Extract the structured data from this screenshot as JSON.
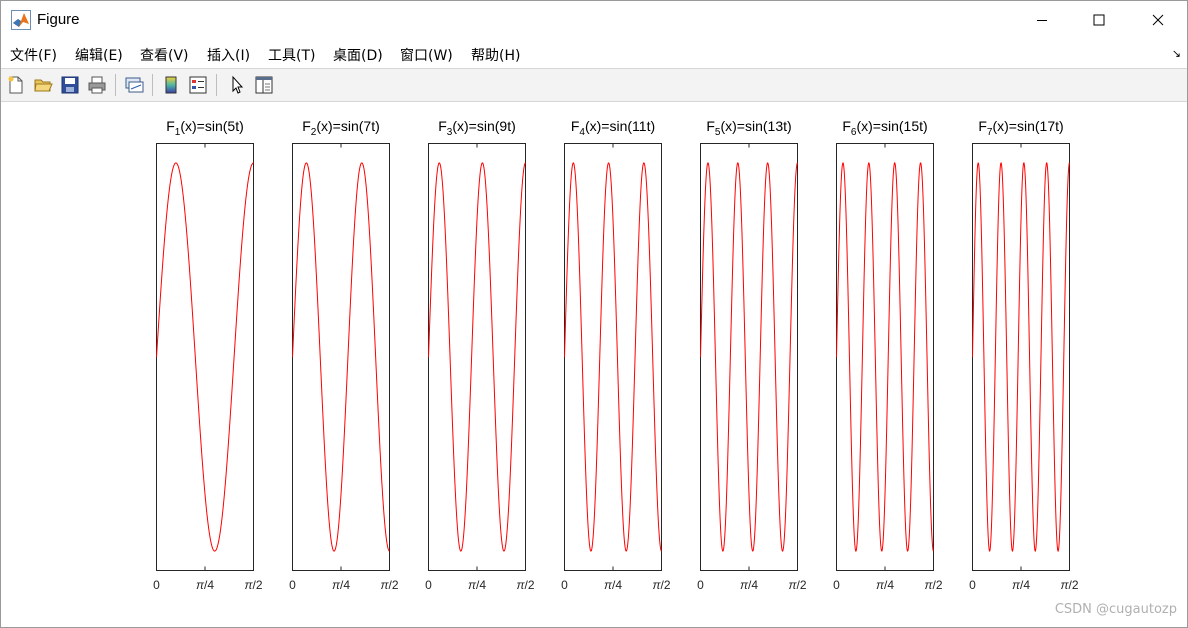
{
  "window": {
    "title": "Figure",
    "icon": "matlab-icon"
  },
  "menu": [
    {
      "label": "文件(F)"
    },
    {
      "label": "编辑(E)"
    },
    {
      "label": "查看(V)"
    },
    {
      "label": "插入(I)"
    },
    {
      "label": "工具(T)"
    },
    {
      "label": "桌面(D)"
    },
    {
      "label": "窗口(W)"
    },
    {
      "label": "帮助(H)"
    }
  ],
  "toolbar": {
    "icons": [
      "new-file-icon",
      "open-folder-icon",
      "save-icon",
      "print-icon",
      "link-plot-icon",
      "colorbar-icon",
      "legend-icon",
      "pointer-icon",
      "property-editor-icon"
    ]
  },
  "watermark": "CSDN @cugautozp",
  "chart_data": [
    {
      "type": "line",
      "title": "F",
      "title_sub": "1",
      "title_rest": "(x)=sin(5t)",
      "freq": 5,
      "x_ticks": [
        "0",
        "π/4",
        "π/2"
      ],
      "xlim": [
        0,
        1.5708
      ],
      "ylim": [
        -1.1,
        1.1
      ],
      "line_color": "#ff0000"
    },
    {
      "type": "line",
      "title": "F",
      "title_sub": "2",
      "title_rest": "(x)=sin(7t)",
      "freq": 7,
      "x_ticks": [
        "0",
        "π/4",
        "π/2"
      ],
      "xlim": [
        0,
        1.5708
      ],
      "ylim": [
        -1.1,
        1.1
      ],
      "line_color": "#ff0000"
    },
    {
      "type": "line",
      "title": "F",
      "title_sub": "3",
      "title_rest": "(x)=sin(9t)",
      "freq": 9,
      "x_ticks": [
        "0",
        "π/4",
        "π/2"
      ],
      "xlim": [
        0,
        1.5708
      ],
      "ylim": [
        -1.1,
        1.1
      ],
      "line_color": "#ff0000"
    },
    {
      "type": "line",
      "title": "F",
      "title_sub": "4",
      "title_rest": "(x)=sin(11t)",
      "freq": 11,
      "x_ticks": [
        "0",
        "π/4",
        "π/2"
      ],
      "xlim": [
        0,
        1.5708
      ],
      "ylim": [
        -1.1,
        1.1
      ],
      "line_color": "#ff0000"
    },
    {
      "type": "line",
      "title": "F",
      "title_sub": "5",
      "title_rest": "(x)=sin(13t)",
      "freq": 13,
      "x_ticks": [
        "0",
        "π/4",
        "π/2"
      ],
      "xlim": [
        0,
        1.5708
      ],
      "ylim": [
        -1.1,
        1.1
      ],
      "line_color": "#ff0000"
    },
    {
      "type": "line",
      "title": "F",
      "title_sub": "6",
      "title_rest": "(x)=sin(15t)",
      "freq": 15,
      "x_ticks": [
        "0",
        "π/4",
        "π/2"
      ],
      "xlim": [
        0,
        1.5708
      ],
      "ylim": [
        -1.1,
        1.1
      ],
      "line_color": "#ff0000"
    },
    {
      "type": "line",
      "title": "F",
      "title_sub": "7",
      "title_rest": "(x)=sin(17t)",
      "freq": 17,
      "x_ticks": [
        "0",
        "π/4",
        "π/2"
      ],
      "xlim": [
        0,
        1.5708
      ],
      "ylim": [
        -1.1,
        1.1
      ],
      "line_color": "#ff0000"
    }
  ]
}
